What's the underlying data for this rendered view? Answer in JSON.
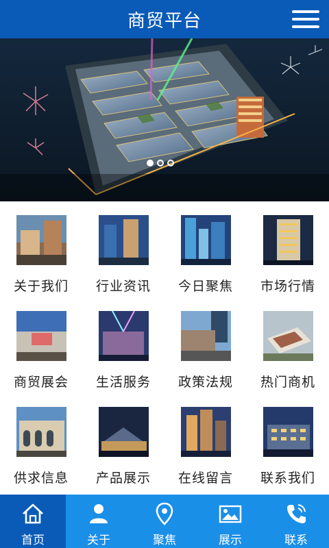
{
  "header": {
    "title": "商贸平台",
    "menu_icon": "hamburger-menu-icon"
  },
  "banner": {
    "image": "commercial-complex-aerial-night-photo",
    "slides": 3,
    "active_slide": 1
  },
  "grid": {
    "items": [
      {
        "label": "关于我们",
        "image": "street-shops-photo"
      },
      {
        "label": "行业资讯",
        "image": "twin-towers-photo"
      },
      {
        "label": "今日聚焦",
        "image": "skyscrapers-photo"
      },
      {
        "label": "市场行情",
        "image": "hotel-tower-night-photo"
      },
      {
        "label": "商贸展会",
        "image": "exhibition-hall-photo"
      },
      {
        "label": "生活服务",
        "image": "mall-night-lights-photo"
      },
      {
        "label": "政策法规",
        "image": "plaza-complex-photo"
      },
      {
        "label": "热门商机",
        "image": "aerial-mall-photo"
      },
      {
        "label": "供求信息",
        "image": "arcade-building-photo"
      },
      {
        "label": "产品展示",
        "image": "plaza-night-photo"
      },
      {
        "label": "在线留言",
        "image": "city-towers-photo"
      },
      {
        "label": "联系我们",
        "image": "blue-building-night-photo"
      }
    ]
  },
  "bottom_nav": {
    "items": [
      {
        "label": "首页",
        "icon": "home-icon",
        "active": true
      },
      {
        "label": "关于",
        "icon": "user-icon",
        "active": false
      },
      {
        "label": "聚焦",
        "icon": "location-pin-icon",
        "active": false
      },
      {
        "label": "展示",
        "icon": "image-icon",
        "active": false
      },
      {
        "label": "联系",
        "icon": "phone-icon",
        "active": false
      }
    ]
  },
  "colors": {
    "header": "#0a5bb8",
    "nav": "#1a8fe8",
    "nav_active": "#0a5bb8"
  }
}
